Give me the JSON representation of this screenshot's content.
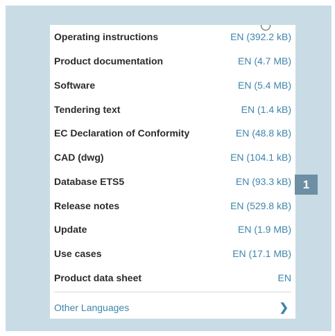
{
  "downloads": [
    {
      "label": "Operating instructions",
      "link": "EN (392.2 kB)"
    },
    {
      "label": "Product documentation",
      "link": "EN (4.7 MB)"
    },
    {
      "label": "Software",
      "link": "EN (5.4 MB)"
    },
    {
      "label": "Tendering text",
      "link": "EN (1.4 kB)"
    },
    {
      "label": "EC Declaration of Conformity",
      "link": "EN (48.8 kB)"
    },
    {
      "label": "CAD (dwg)",
      "link": "EN (104.1 kB)"
    },
    {
      "label": "Database ETS5",
      "link": "EN (93.3 kB)"
    },
    {
      "label": "Release notes",
      "link": "EN (529.8 kB)"
    },
    {
      "label": "Update",
      "link": "EN (1.9 MB)"
    },
    {
      "label": "Use cases",
      "link": "EN (17.1 MB)"
    },
    {
      "label": "Product data sheet",
      "link": "EN"
    }
  ],
  "other_languages": {
    "label": "Other Languages",
    "chevron": "❯"
  },
  "callout": {
    "number": "1"
  },
  "colors": {
    "link": "#3e85ad",
    "frame": "#c9dce5",
    "callout": "#6d8ea3"
  }
}
